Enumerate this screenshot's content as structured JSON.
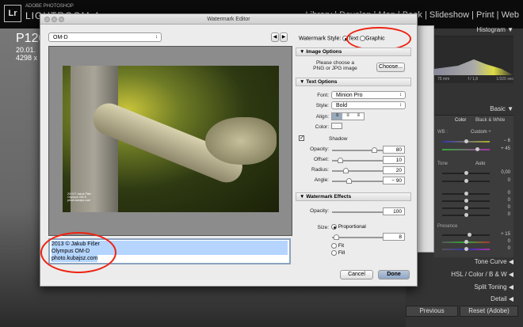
{
  "app": {
    "brand_top": "ADOBE PHOTOSHOP",
    "brand_name": "LIGHTROOM 4",
    "logo": "Lr",
    "modules": "Library | Develop | Map | Book | Slideshow | Print | Web"
  },
  "photo_info": {
    "name": "P120",
    "date": "20.01.",
    "dims": "4298 x"
  },
  "right_panel": {
    "histogram": "Histogram ▼",
    "exif": [
      "75 mm",
      "f / 1,8",
      "1/320 sec"
    ],
    "basic": "Basic ▼",
    "color": "Color",
    "bw": "Black & White",
    "wb": "WB :",
    "wb_value": "Custom ÷",
    "wb_vals": [
      "− 6",
      "+ 45"
    ],
    "tone": "Tone",
    "auto": "Auto",
    "tone_vals": [
      "0,00",
      "0",
      "0",
      "0",
      "0",
      "0"
    ],
    "presence": "Presence",
    "presence_vals": [
      "+ 15",
      "0",
      "0"
    ],
    "tone_curve": "Tone Curve ◀",
    "hsl": "HSL / Color / B & W ◀",
    "split_toning": "Split Toning ◀",
    "detail": "Detail ◀",
    "previous": "Previous",
    "reset": "Reset (Adobe)"
  },
  "dialog": {
    "title": "Watermark Editor",
    "preset": "OM-D",
    "watermark_lines": [
      "2013 © Jakub Fišer",
      "Olympus OM-D",
      "photo.kubajsz.com"
    ],
    "style_label": "Watermark Style:",
    "style_text": "Text",
    "style_graphic": "Graphic",
    "image_options": "Image Options",
    "choose_hint_1": "Please choose a",
    "choose_hint_2": "PNG or JPG image",
    "choose": "Choose...",
    "text_options": "Text Options",
    "font_label": "Font:",
    "font": "Minion Pro",
    "style_label2": "Style:",
    "style": "Bold",
    "align_label": "Align:",
    "color_label": "Color:",
    "shadow": "Shadow",
    "opacity_label": "Opacity:",
    "shadow_opacity": "80",
    "offset_label": "Offset:",
    "offset": "10",
    "radius_label": "Radius:",
    "radius": "20",
    "angle_label": "Angle:",
    "angle": "− 90",
    "effects": "Watermark Effects",
    "eff_opacity_label": "Opacity:",
    "eff_opacity": "100",
    "size_label": "Size:",
    "proportional": "Proportional",
    "size": "8",
    "fit": "Fit",
    "fill": "Fill",
    "cancel": "Cancel",
    "done": "Done"
  },
  "colors": {
    "accent_ring": "#e21",
    "selection": "#b5d5ff"
  }
}
